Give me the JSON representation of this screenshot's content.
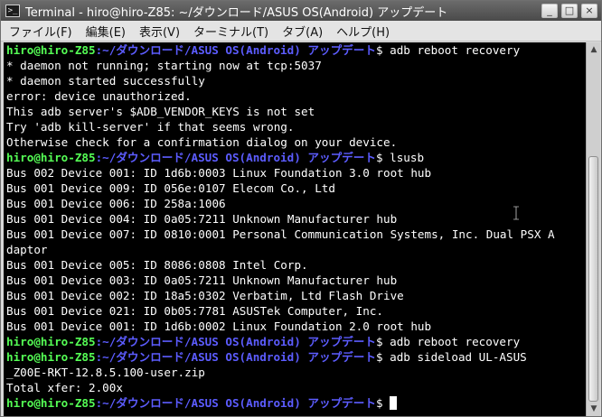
{
  "window": {
    "title": "Terminal - hiro@hiro-Z85: ~/ダウンロード/ASUS OS(Android) アップデート",
    "buttons": {
      "minimize": "_",
      "maximize": "□",
      "close": "×"
    },
    "icon_glyph": ">_"
  },
  "menu": [
    "ファイル(F)",
    "編集(E)",
    "表示(V)",
    "ターミナル(T)",
    "タブ(A)",
    "ヘルプ(H)"
  ],
  "colors": {
    "user": "#55ff55",
    "path": "#5c5cff",
    "text": "#ffffff",
    "background": "#000000"
  },
  "terminal": {
    "lines": [
      {
        "type": "prompt",
        "user": "hiro@hiro-Z85",
        "sep": ":",
        "path": "~/ダウンロード/ASUS OS(Android) アップデート",
        "cmd": "$ adb reboot recovery"
      },
      {
        "type": "out",
        "text": "* daemon not running; starting now at tcp:5037"
      },
      {
        "type": "out",
        "text": "* daemon started successfully"
      },
      {
        "type": "out",
        "text": "error: device unauthorized."
      },
      {
        "type": "out",
        "text": "This adb server's $ADB_VENDOR_KEYS is not set"
      },
      {
        "type": "out",
        "text": "Try 'adb kill-server' if that seems wrong."
      },
      {
        "type": "out",
        "text": "Otherwise check for a confirmation dialog on your device."
      },
      {
        "type": "prompt",
        "user": "hiro@hiro-Z85",
        "sep": ":",
        "path": "~/ダウンロード/ASUS OS(Android) アップデート",
        "cmd": "$ lsusb"
      },
      {
        "type": "out",
        "text": "Bus 002 Device 001: ID 1d6b:0003 Linux Foundation 3.0 root hub"
      },
      {
        "type": "out",
        "text": "Bus 001 Device 009: ID 056e:0107 Elecom Co., Ltd"
      },
      {
        "type": "out",
        "text": "Bus 001 Device 006: ID 258a:1006"
      },
      {
        "type": "out",
        "text": "Bus 001 Device 004: ID 0a05:7211 Unknown Manufacturer hub"
      },
      {
        "type": "out",
        "text": "Bus 001 Device 007: ID 0810:0001 Personal Communication Systems, Inc. Dual PSX A"
      },
      {
        "type": "out",
        "text": "daptor"
      },
      {
        "type": "out",
        "text": "Bus 001 Device 005: ID 8086:0808 Intel Corp."
      },
      {
        "type": "out",
        "text": "Bus 001 Device 003: ID 0a05:7211 Unknown Manufacturer hub"
      },
      {
        "type": "out",
        "text": "Bus 001 Device 002: ID 18a5:0302 Verbatim, Ltd Flash Drive"
      },
      {
        "type": "out",
        "text": "Bus 001 Device 021: ID 0b05:7781 ASUSTek Computer, Inc."
      },
      {
        "type": "out",
        "text": "Bus 001 Device 001: ID 1d6b:0002 Linux Foundation 2.0 root hub"
      },
      {
        "type": "prompt",
        "user": "hiro@hiro-Z85",
        "sep": ":",
        "path": "~/ダウンロード/ASUS OS(Android) アップデート",
        "cmd": "$ adb reboot recovery"
      },
      {
        "type": "prompt",
        "user": "hiro@hiro-Z85",
        "sep": ":",
        "path": "~/ダウンロード/ASUS OS(Android) アップデート",
        "cmd": "$ adb sideload UL-ASUS"
      },
      {
        "type": "out",
        "text": "_Z00E-RKT-12.8.5.100-user.zip"
      },
      {
        "type": "out",
        "text": "Total xfer: 2.00x"
      },
      {
        "type": "prompt",
        "user": "hiro@hiro-Z85",
        "sep": ":",
        "path": "~/ダウンロード/ASUS OS(Android) アップデート",
        "cmd": "$ ",
        "cursor": true
      }
    ]
  },
  "scrollbar": {
    "up_arrow": "▲",
    "down_arrow": "▼"
  }
}
